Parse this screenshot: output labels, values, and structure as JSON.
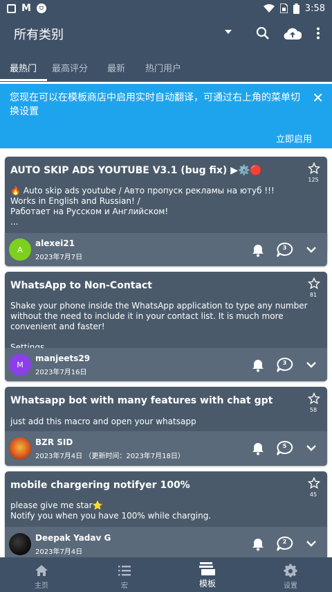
{
  "status_bar": {
    "time": "3:58"
  },
  "app_bar": {
    "title": "所有类别"
  },
  "tabs": [
    {
      "label": "最热门",
      "active": true
    },
    {
      "label": "最高评分"
    },
    {
      "label": "最新"
    },
    {
      "label": "热门用户"
    }
  ],
  "banner": {
    "message": "您现在可以在模板商店中启用实时自动翻译，可通过右上角的菜单切换设置",
    "action_label": "立即启用"
  },
  "cards": [
    {
      "title": "AUTO SKIP ADS YOUTUBE V3.1 (bug fix) ▶⚙️🔴",
      "description": "🔥 Auto skip ads youtube / Авто пропуск рекламы на ютуб !!!\nWorks in English and Russian! /\n Работает на Русском и Английском!\n...",
      "stars": "125",
      "user": "alexei21",
      "avatar_letter": "A",
      "avatar_color": "#7bd11e",
      "date": "2023年7月7日",
      "comments": "3"
    },
    {
      "title": "WhatsApp to Non-Contact",
      "description": "Shake your phone inside the WhatsApp application to type any number without the need to include it in your contact list. It is much more convenient and faster!\n\nSettings...",
      "stars": "81",
      "user": "manjeets29",
      "avatar_letter": "M",
      "avatar_color": "#8a3fe8",
      "date": "2023年7月16日",
      "comments": "3"
    },
    {
      "title": "Whatsapp bot with many features with chat gpt",
      "description": "just add this macro and open your whatsapp",
      "stars": "58",
      "user": "BZR SID",
      "avatar_letter": "",
      "avatar_color": "#d8581f",
      "date": "2023年7月4日  （更新时间：2023年7月18日）",
      "comments": "5"
    },
    {
      "title": "mobile chargering notifyer 100%",
      "description": "please give me star⭐\nNotify you when you have 100% while charging.",
      "stars": "45",
      "user": "Deepak Yadav G",
      "avatar_letter": "",
      "avatar_color": "#111111",
      "date": "2023年7月4日",
      "comments": "2"
    }
  ],
  "bottom_nav": [
    {
      "label": "主页",
      "icon": "home-icon"
    },
    {
      "label": "宏",
      "icon": "list-icon"
    },
    {
      "label": "模板",
      "icon": "templates-icon",
      "active": true
    },
    {
      "label": "设置",
      "icon": "gear-icon"
    }
  ],
  "colors": {
    "primary": "#3f5166",
    "banner": "#1ea4ec",
    "card": "#4a5a6a",
    "card_footer": "#5a6a7a"
  }
}
